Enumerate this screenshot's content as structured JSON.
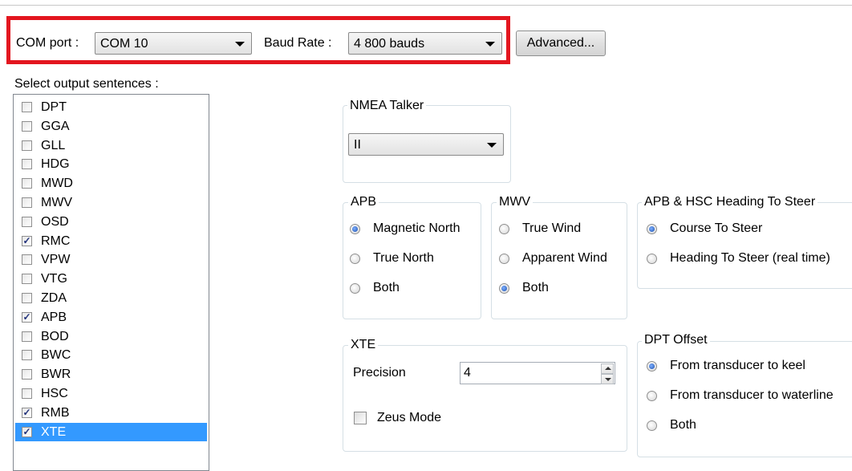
{
  "com": {
    "label": "COM port :",
    "value": "COM 10"
  },
  "baud": {
    "label": "Baud Rate :",
    "value": "4 800 bauds"
  },
  "advanced_label": "Advanced...",
  "sentences": {
    "label": "Select output sentences :",
    "items": [
      {
        "name": "DPT",
        "checked": false
      },
      {
        "name": "GGA",
        "checked": false
      },
      {
        "name": "GLL",
        "checked": false
      },
      {
        "name": "HDG",
        "checked": false
      },
      {
        "name": "MWD",
        "checked": false
      },
      {
        "name": "MWV",
        "checked": false
      },
      {
        "name": "OSD",
        "checked": false
      },
      {
        "name": "RMC",
        "checked": true
      },
      {
        "name": "VPW",
        "checked": false
      },
      {
        "name": "VTG",
        "checked": false
      },
      {
        "name": "ZDA",
        "checked": false
      },
      {
        "name": "APB",
        "checked": true
      },
      {
        "name": "BOD",
        "checked": false
      },
      {
        "name": "BWC",
        "checked": false
      },
      {
        "name": "BWR",
        "checked": false
      },
      {
        "name": "HSC",
        "checked": false
      },
      {
        "name": "RMB",
        "checked": true
      },
      {
        "name": "XTE",
        "checked": true,
        "selected": true
      }
    ]
  },
  "talker": {
    "title": "NMEA Talker",
    "value": "II"
  },
  "apb": {
    "title": "APB",
    "options": [
      {
        "label": "Magnetic North",
        "checked": true
      },
      {
        "label": "True North",
        "checked": false
      },
      {
        "label": "Both",
        "checked": false
      }
    ]
  },
  "mwv": {
    "title": "MWV",
    "options": [
      {
        "label": "True Wind",
        "checked": false
      },
      {
        "label": "Apparent Wind",
        "checked": false
      },
      {
        "label": "Both",
        "checked": true
      }
    ]
  },
  "steer": {
    "title": "APB & HSC Heading To Steer",
    "options": [
      {
        "label": "Course To Steer",
        "checked": true
      },
      {
        "label": "Heading To Steer (real time)",
        "checked": false
      }
    ]
  },
  "xte": {
    "title": "XTE",
    "precision_label": "Precision",
    "precision_value": "4",
    "zeus_label": "Zeus Mode",
    "zeus_checked": false
  },
  "dpt": {
    "title": "DPT Offset",
    "options": [
      {
        "label": "From transducer to keel",
        "checked": true
      },
      {
        "label": "From transducer to waterline",
        "checked": false
      },
      {
        "label": "Both",
        "checked": false
      }
    ]
  }
}
